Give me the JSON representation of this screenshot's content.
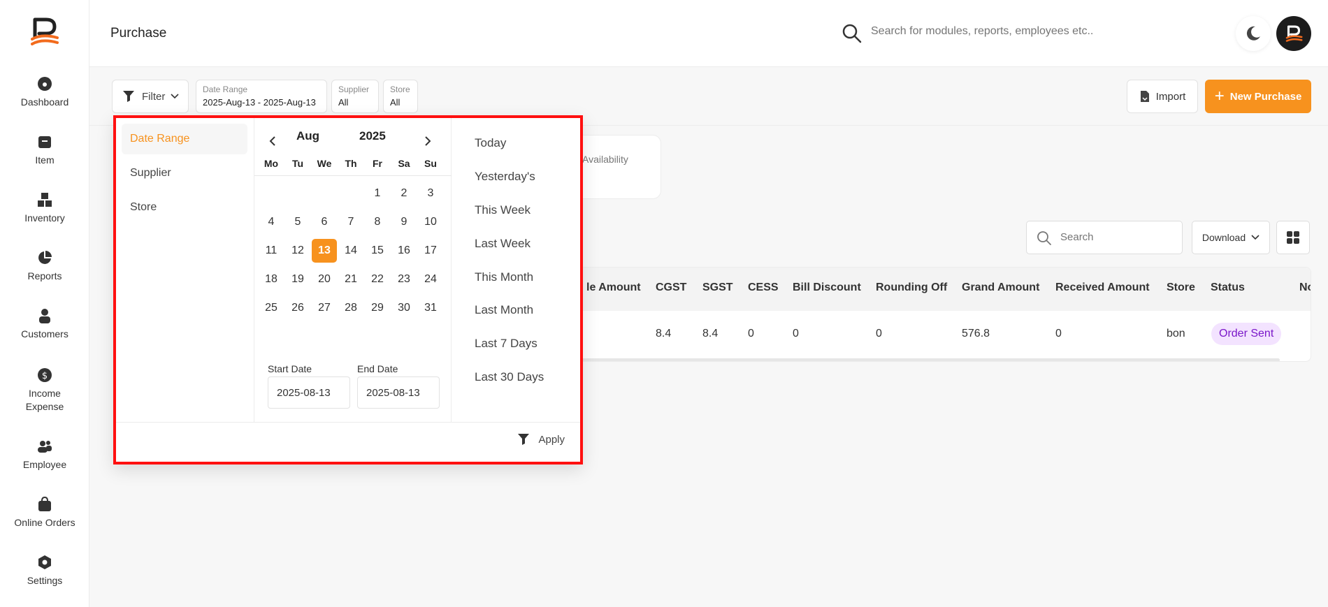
{
  "sidebar": {
    "items": [
      {
        "label": "Dashboard",
        "icon": "dashboard-icon"
      },
      {
        "label": "Item",
        "icon": "item-icon"
      },
      {
        "label": "Inventory",
        "icon": "inventory-icon"
      },
      {
        "label": "Reports",
        "icon": "reports-icon"
      },
      {
        "label": "Customers",
        "icon": "customers-icon"
      },
      {
        "label": "Income Expense",
        "icon": "income-expense-icon"
      },
      {
        "label": "Employee",
        "icon": "employee-icon"
      },
      {
        "label": "Online Orders",
        "icon": "online-orders-icon"
      },
      {
        "label": "Settings",
        "icon": "settings-icon"
      }
    ]
  },
  "header": {
    "title": "Purchase",
    "search_placeholder": "Search for modules, reports, employees etc.."
  },
  "toolbar": {
    "filter_label": "Filter",
    "chips": [
      {
        "label": "Date Range",
        "value": "2025-Aug-13 - 2025-Aug-13"
      },
      {
        "label": "Supplier",
        "value": "All"
      },
      {
        "label": "Store",
        "value": "All"
      }
    ],
    "import_label": "Import",
    "new_label": "New Purchase"
  },
  "content": {
    "availability_text": "Availability",
    "search_placeholder": "Search",
    "download_label": "Download"
  },
  "table": {
    "headers": [
      "le Amount",
      "CGST",
      "SGST",
      "CESS",
      "Bill Discount",
      "Rounding Off",
      "Grand Amount",
      "Received Amount",
      "Store",
      "Status",
      "No"
    ],
    "row": [
      "",
      "8.4",
      "8.4",
      "0",
      "0",
      "0",
      "576.8",
      "0",
      "bon"
    ],
    "status": "Order Sent"
  },
  "dropdown": {
    "options": [
      "Date Range",
      "Supplier",
      "Store"
    ],
    "active_option": "Date Range",
    "calendar": {
      "month": "Aug",
      "year": "2025",
      "weekdays": [
        "Mo",
        "Tu",
        "We",
        "Th",
        "Fr",
        "Sa",
        "Su"
      ],
      "days": [
        "1",
        "2",
        "3",
        "4",
        "5",
        "6",
        "7",
        "8",
        "9",
        "10",
        "11",
        "12",
        "13",
        "14",
        "15",
        "16",
        "17",
        "18",
        "19",
        "20",
        "21",
        "22",
        "23",
        "24",
        "25",
        "26",
        "27",
        "28",
        "29",
        "30",
        "31"
      ],
      "first_weekday_index": 4,
      "selected_day": "13"
    },
    "start_date_label": "Start Date",
    "start_date_value": "2025-08-13",
    "end_date_label": "End Date",
    "end_date_value": "2025-08-13",
    "quick_ranges": [
      "Today",
      "Yesterday's",
      "This Week",
      "Last Week",
      "This Month",
      "Last Month",
      "Last 7 Days",
      "Last 30 Days"
    ],
    "apply_label": "Apply"
  },
  "colors": {
    "accent": "#f7921e",
    "highlight_border": "#ff1010",
    "status_bg": "#f3e3ff",
    "status_text": "#7a17c9"
  }
}
